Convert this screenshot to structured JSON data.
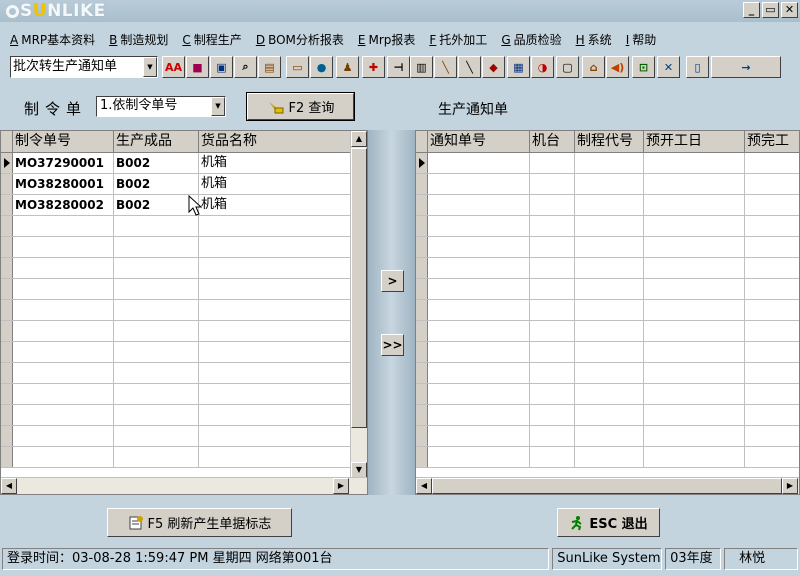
{
  "window": {
    "logo": "SUNLIKE",
    "controls": {
      "minimize": "_",
      "restore": "▭",
      "close": "✕"
    }
  },
  "menu": [
    {
      "key": "A",
      "label": "MRP基本资料"
    },
    {
      "key": "B",
      "label": "制造规划"
    },
    {
      "key": "C",
      "label": "制程生产"
    },
    {
      "key": "D",
      "label": "BOM分析报表"
    },
    {
      "key": "E",
      "label": "Mrp报表"
    },
    {
      "key": "F",
      "label": "托外加工"
    },
    {
      "key": "G",
      "label": "品质检验"
    },
    {
      "key": "H",
      "label": "系统"
    },
    {
      "key": "I",
      "label": "帮助"
    }
  ],
  "toolbar": {
    "combo_value": "批次转生产通知单",
    "buttons": [
      "AA",
      "■",
      "▣",
      "⌕",
      "▤",
      "▭",
      "●",
      "♟",
      "✚",
      "⊣",
      "▥",
      "╲",
      "╲",
      "◆",
      "▦",
      "◑",
      "▢",
      "⌂",
      "◀)",
      "⊡",
      "✕",
      "▯",
      "→"
    ]
  },
  "filter": {
    "label": "制令单",
    "select_value": "1.依制令单号",
    "query_button": "F2 查询"
  },
  "notice_label": "生产通知单",
  "left_grid": {
    "columns": [
      "制令单号",
      "生产成品",
      "货品名称"
    ],
    "rows": [
      [
        "MO37290001",
        "B002",
        "机箱"
      ],
      [
        "MO38280001",
        "B002",
        "机箱"
      ],
      [
        "MO38280002",
        "B002",
        "机箱"
      ]
    ]
  },
  "right_grid": {
    "columns": [
      "通知单号",
      "机台",
      "制程代号",
      "预开工日",
      "预完工"
    ],
    "rows": []
  },
  "transfer": {
    "one": ">",
    "all": ">>"
  },
  "bottom": {
    "refresh_button": "F5 刷新产生单据标志",
    "exit_button": "ESC 退出"
  },
  "status": {
    "login": "登录时间：03-08-28 1:59:47 PM  星期四   网络第001台",
    "system": "SunLike System",
    "year": "03年度",
    "user": "林悦"
  }
}
